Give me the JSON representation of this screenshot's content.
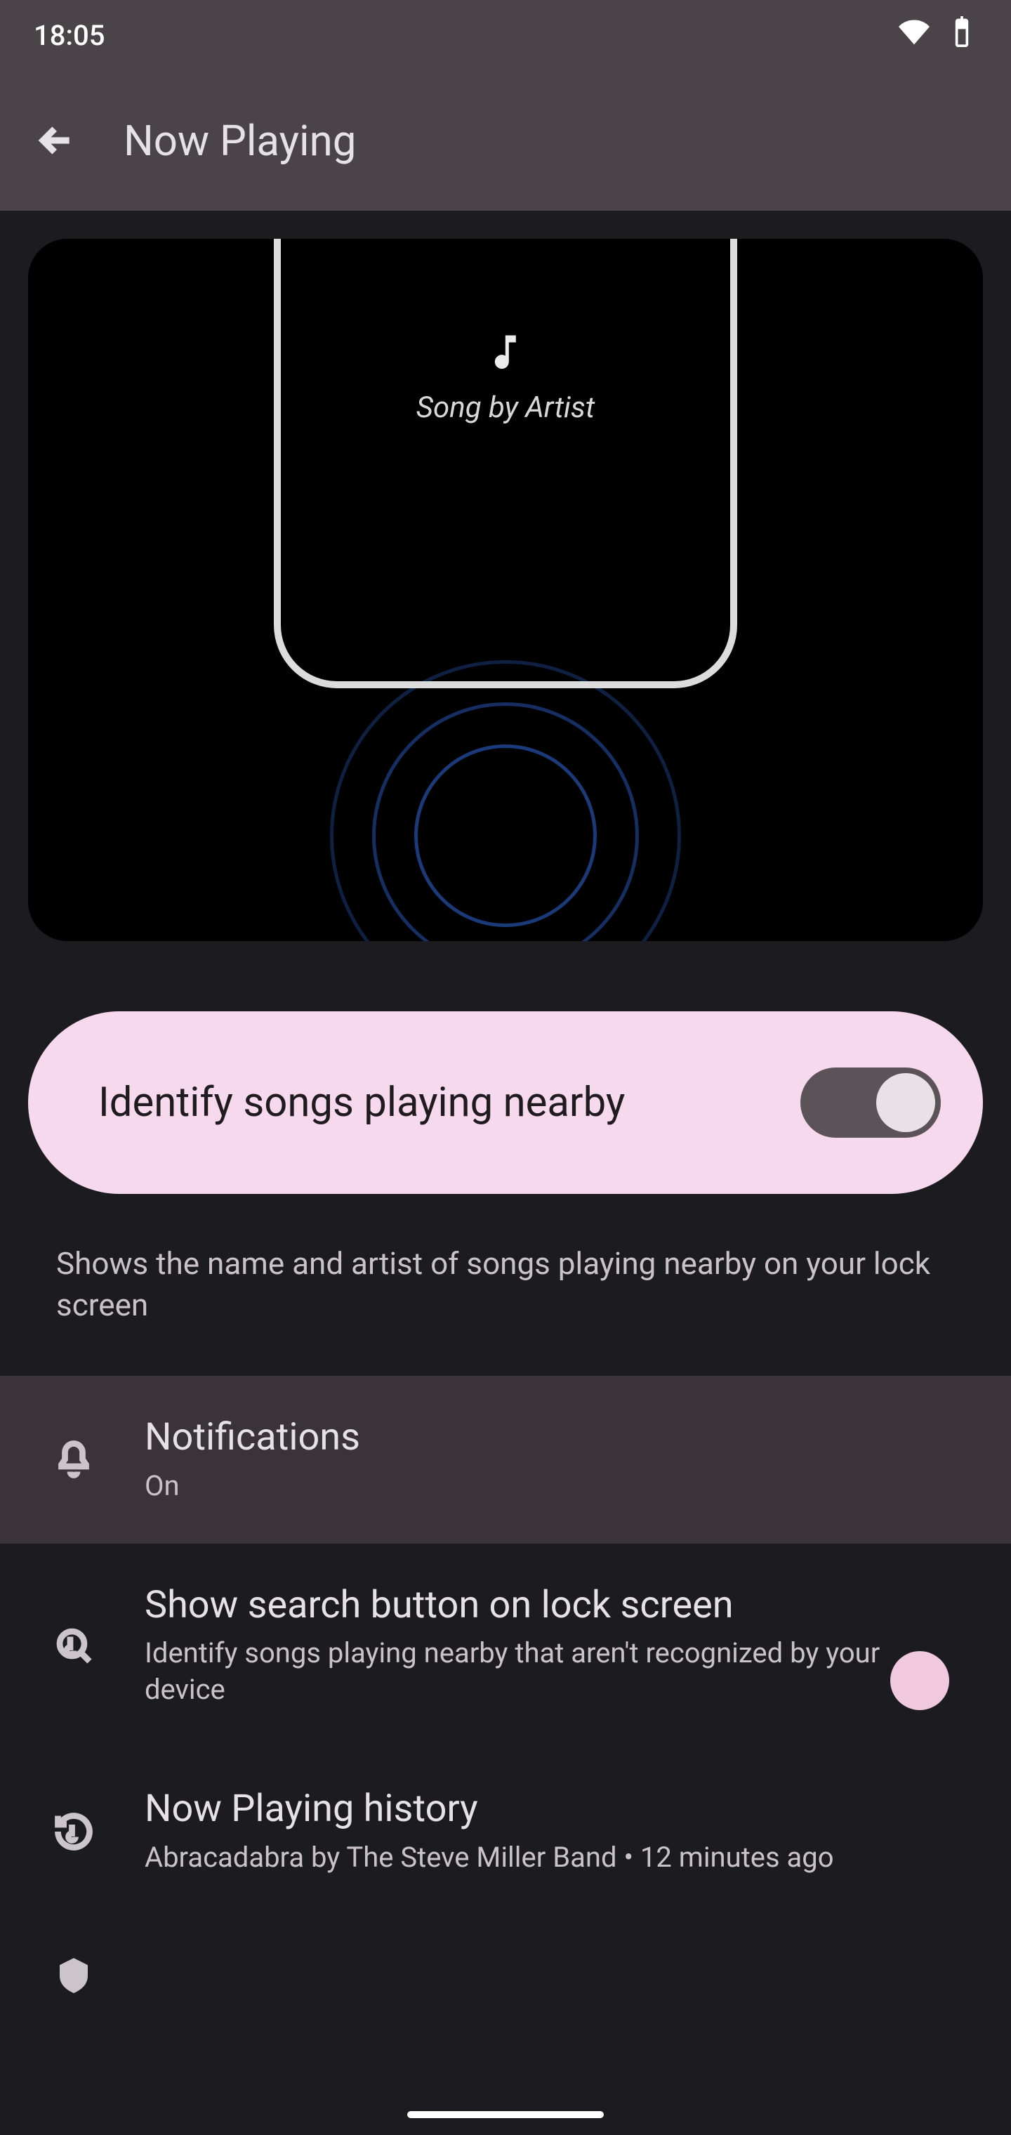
{
  "status": {
    "time": "18:05"
  },
  "header": {
    "title": "Now Playing"
  },
  "hero": {
    "demo_label": "Song by Artist"
  },
  "primary_toggle": {
    "label": "Identify songs playing nearby",
    "enabled": true
  },
  "primary_description": "Shows the name and artist of songs playing nearby on your lock screen",
  "rows": {
    "notifications": {
      "title": "Notifications",
      "sub": "On"
    },
    "search_button": {
      "title": "Show search button on lock screen",
      "sub": "Identify songs playing nearby that aren't recognized by your device",
      "enabled": true
    },
    "history": {
      "title": "Now Playing history",
      "sub": "Abracadabra by The Steve Miller Band • 12 minutes ago"
    }
  },
  "colors": {
    "accent_light": "#f6d9ec",
    "accent_on_light": "#1f1b1e",
    "switch_track_dark": "#5b5358",
    "switch_track_pink": "#9c7d90",
    "background": "#1c1b1f"
  }
}
